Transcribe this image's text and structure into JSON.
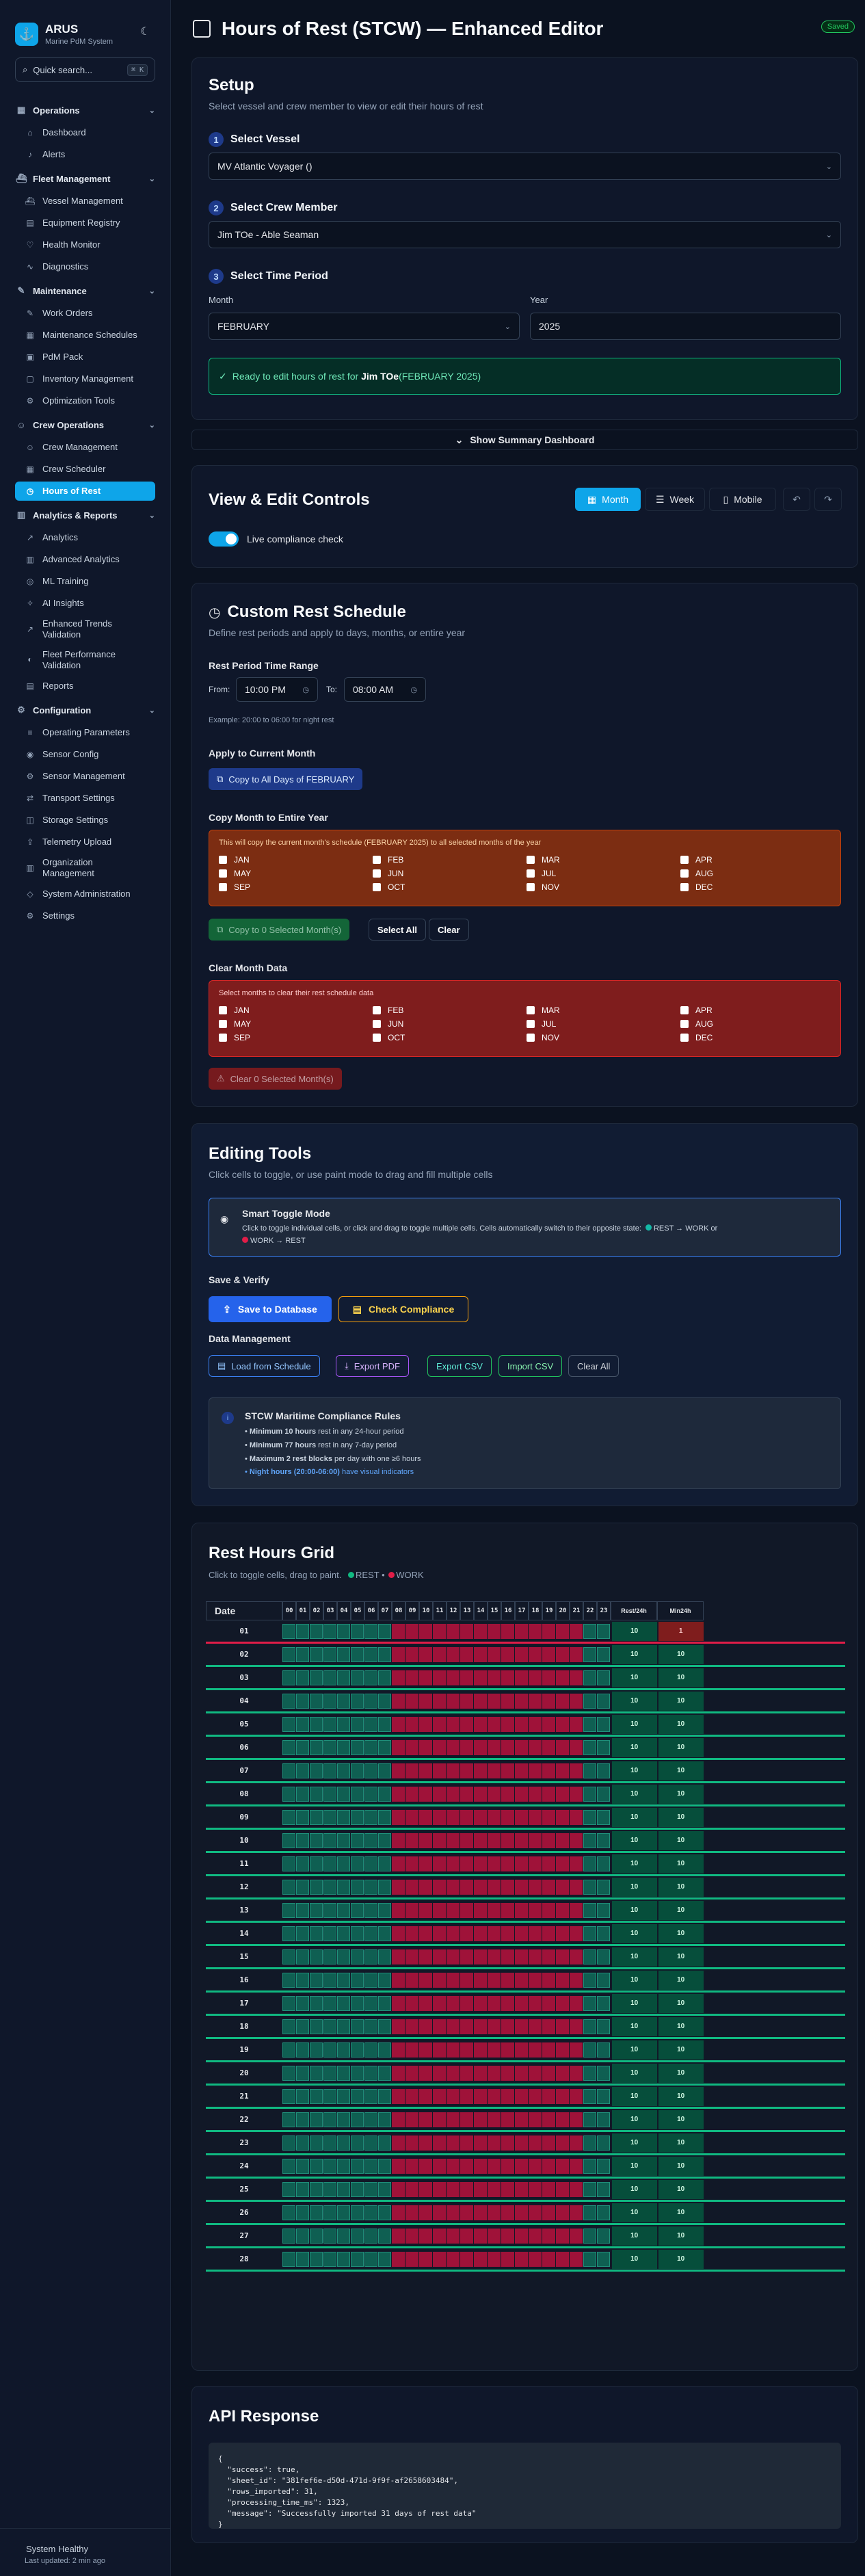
{
  "app": {
    "name": "ARUS",
    "subtitle": "Marine PdM System",
    "search_placeholder": "Quick search...",
    "search_shortcut": "⌘ K"
  },
  "nav": {
    "groups": [
      {
        "label": "Operations",
        "icon": "grid-icon",
        "items": [
          {
            "label": "Dashboard",
            "icon": "home-icon"
          },
          {
            "label": "Alerts",
            "icon": "bell-icon"
          }
        ]
      },
      {
        "label": "Fleet Management",
        "icon": "ship-icon",
        "items": [
          {
            "label": "Vessel Management",
            "icon": "ship-icon"
          },
          {
            "label": "Equipment Registry",
            "icon": "server-icon"
          },
          {
            "label": "Health Monitor",
            "icon": "heart-icon"
          },
          {
            "label": "Diagnostics",
            "icon": "activity-icon"
          }
        ]
      },
      {
        "label": "Maintenance",
        "icon": "wrench-icon",
        "items": [
          {
            "label": "Work Orders",
            "icon": "wrench-icon"
          },
          {
            "label": "Maintenance Schedules",
            "icon": "calendar-icon"
          },
          {
            "label": "PdM Pack",
            "icon": "package-icon"
          },
          {
            "label": "Inventory Management",
            "icon": "box-icon"
          },
          {
            "label": "Optimization Tools",
            "icon": "settings-icon"
          }
        ]
      },
      {
        "label": "Crew Operations",
        "icon": "users-icon",
        "items": [
          {
            "label": "Crew Management",
            "icon": "users-icon"
          },
          {
            "label": "Crew Scheduler",
            "icon": "calendar-icon"
          },
          {
            "label": "Hours of Rest",
            "icon": "clock-icon",
            "active": true
          }
        ]
      },
      {
        "label": "Analytics & Reports",
        "icon": "chart-icon",
        "items": [
          {
            "label": "Analytics",
            "icon": "trend-icon"
          },
          {
            "label": "Advanced Analytics",
            "icon": "chart-icon"
          },
          {
            "label": "ML Training",
            "icon": "brain-icon"
          },
          {
            "label": "AI Insights",
            "icon": "sparkle-icon"
          },
          {
            "label": "Enhanced Trends Validation",
            "icon": "trend-icon"
          },
          {
            "label": "Fleet Performance Validation",
            "icon": "gauge-icon"
          },
          {
            "label": "Reports",
            "icon": "file-icon"
          }
        ]
      },
      {
        "label": "Configuration",
        "icon": "gear-icon",
        "items": [
          {
            "label": "Operating Parameters",
            "icon": "sliders-icon"
          },
          {
            "label": "Sensor Config",
            "icon": "sensor-icon"
          },
          {
            "label": "Sensor Management",
            "icon": "gear-icon"
          },
          {
            "label": "Transport Settings",
            "icon": "transport-icon"
          },
          {
            "label": "Storage Settings",
            "icon": "database-icon"
          },
          {
            "label": "Telemetry Upload",
            "icon": "upload-icon"
          },
          {
            "label": "Organization Management",
            "icon": "building-icon"
          },
          {
            "label": "System Administration",
            "icon": "shield-icon"
          },
          {
            "label": "Settings",
            "icon": "gear-icon"
          }
        ]
      }
    ]
  },
  "footer": {
    "status": "System Healthy",
    "updated": "Last updated: 2 min ago"
  },
  "page": {
    "title": "Hours of Rest (STCW) — Enhanced Editor",
    "saved_badge": "Saved"
  },
  "setup": {
    "title": "Setup",
    "subtitle": "Select vessel and crew member to view or edit their hours of rest",
    "step1": "Select Vessel",
    "vessel": "MV Atlantic Voyager ()",
    "step2": "Select Crew Member",
    "crew": "Jim TOe - Able Seaman",
    "step3": "Select Time Period",
    "month_label": "Month",
    "month": "FEBRUARY",
    "year_label": "Year",
    "year": "2025",
    "ready_prefix": "Ready to edit hours of rest for ",
    "ready_name": "Jim TOe",
    "ready_suffix": " (FEBRUARY 2025)"
  },
  "summary_toggle": "Show Summary Dashboard",
  "view_controls": {
    "title": "View & Edit Controls",
    "month": "Month",
    "week": "Week",
    "mobile": "Mobile",
    "live_check": "Live compliance check"
  },
  "custom_rest": {
    "title": "Custom Rest Schedule",
    "subtitle": "Define rest periods and apply to days, months, or entire year",
    "range_label": "Rest Period Time Range",
    "from_label": "From:",
    "from": "10:00 PM",
    "to_label": "To:",
    "to": "08:00 AM",
    "example": "Example: 20:00 to 06:00 for night rest",
    "apply_label": "Apply to Current Month",
    "apply_button": "Copy to All Days of FEBRUARY",
    "copy_year_label": "Copy Month to Entire Year",
    "copy_notice": "This will copy the current month's schedule (FEBRUARY 2025) to all selected months of the year",
    "months": [
      "JAN",
      "FEB",
      "MAR",
      "APR",
      "MAY",
      "JUN",
      "JUL",
      "AUG",
      "SEP",
      "OCT",
      "NOV",
      "DEC"
    ],
    "copy_button": "Copy to 0 Selected Month(s)",
    "select_all": "Select All",
    "clear": "Clear",
    "clear_label": "Clear Month Data",
    "clear_notice": "Select months to clear their rest schedule data",
    "clear_button": "Clear 0 Selected Month(s)"
  },
  "editing": {
    "title": "Editing Tools",
    "subtitle": "Click cells to toggle, or use paint mode to drag and fill multiple cells",
    "smart_title": "Smart Toggle Mode",
    "smart_desc1": "Click to toggle individual cells, or click and drag to toggle multiple cells. Cells automatically switch to their opposite state: ",
    "smart_rest_work": "REST → WORK or",
    "smart_work_rest": "WORK → REST",
    "save_verify": "Save & Verify",
    "save_db": "Save to Database",
    "check": "Check Compliance",
    "data_mgmt": "Data Management",
    "load": "Load from Schedule",
    "export_pdf": "Export PDF",
    "export_csv": "Export CSV",
    "import_csv": "Import CSV",
    "clear_all": "Clear All",
    "rules_title": "STCW Maritime Compliance Rules",
    "rules": [
      {
        "bold": "Minimum 10 hours",
        "rest": " rest in any 24-hour period"
      },
      {
        "bold": "Minimum 77 hours",
        "rest": " rest in any 7-day period"
      },
      {
        "bold": "Maximum 2 rest blocks",
        "rest": " per day with one ≥6 hours"
      },
      {
        "bold": "Night hours (20:00-06:00)",
        "rest": " have visual indicators"
      }
    ]
  },
  "grid": {
    "title": "Rest Hours Grid",
    "subtitle_prefix": "Click to toggle cells, drag to paint.",
    "rest": "REST",
    "work": "WORK",
    "date_header": "Date",
    "hours": [
      "00",
      "01",
      "02",
      "03",
      "04",
      "05",
      "06",
      "07",
      "08",
      "09",
      "10",
      "11",
      "12",
      "13",
      "14",
      "15",
      "16",
      "17",
      "18",
      "19",
      "20",
      "21",
      "22",
      "23"
    ],
    "rest24_header": "Rest/24h",
    "min24_header": "Min24h",
    "rows": [
      {
        "date": "01",
        "rest": "10",
        "min": "1"
      },
      {
        "date": "02",
        "rest": "10",
        "min": "10"
      },
      {
        "date": "03",
        "rest": "10",
        "min": "10"
      },
      {
        "date": "04",
        "rest": "10",
        "min": "10"
      },
      {
        "date": "05",
        "rest": "10",
        "min": "10"
      },
      {
        "date": "06",
        "rest": "10",
        "min": "10"
      },
      {
        "date": "07",
        "rest": "10",
        "min": "10"
      },
      {
        "date": "08",
        "rest": "10",
        "min": "10"
      },
      {
        "date": "09",
        "rest": "10",
        "min": "10"
      },
      {
        "date": "10",
        "rest": "10",
        "min": "10"
      },
      {
        "date": "11",
        "rest": "10",
        "min": "10"
      },
      {
        "date": "12",
        "rest": "10",
        "min": "10"
      },
      {
        "date": "13",
        "rest": "10",
        "min": "10"
      },
      {
        "date": "14",
        "rest": "10",
        "min": "10"
      },
      {
        "date": "15",
        "rest": "10",
        "min": "10"
      },
      {
        "date": "16",
        "rest": "10",
        "min": "10"
      },
      {
        "date": "17",
        "rest": "10",
        "min": "10"
      },
      {
        "date": "18",
        "rest": "10",
        "min": "10"
      },
      {
        "date": "19",
        "rest": "10",
        "min": "10"
      },
      {
        "date": "20",
        "rest": "10",
        "min": "10"
      },
      {
        "date": "21",
        "rest": "10",
        "min": "10"
      },
      {
        "date": "22",
        "rest": "10",
        "min": "10"
      },
      {
        "date": "23",
        "rest": "10",
        "min": "10"
      },
      {
        "date": "24",
        "rest": "10",
        "min": "10"
      },
      {
        "date": "25",
        "rest": "10",
        "min": "10"
      },
      {
        "date": "26",
        "rest": "10",
        "min": "10"
      },
      {
        "date": "27",
        "rest": "10",
        "min": "10"
      },
      {
        "date": "28",
        "rest": "10",
        "min": "10"
      }
    ],
    "rest_hours": [
      0,
      1,
      2,
      3,
      4,
      5,
      6,
      7,
      22,
      23
    ]
  },
  "api": {
    "title": "API Response",
    "lines": [
      "{",
      "  \"success\": true,",
      "  \"sheet_id\": \"381fef6e-d50d-471d-9f9f-af2658603484\",",
      "  \"rows_imported\": 31,",
      "  \"processing_time_ms\": 1323,",
      "  \"message\": \"Successfully imported 31 days of rest data\"",
      "}"
    ]
  },
  "colors": {
    "accent": "#0ea5e9",
    "rest": "#0f5f52",
    "work": "#9f1239",
    "primary_button": "#2563eb"
  }
}
